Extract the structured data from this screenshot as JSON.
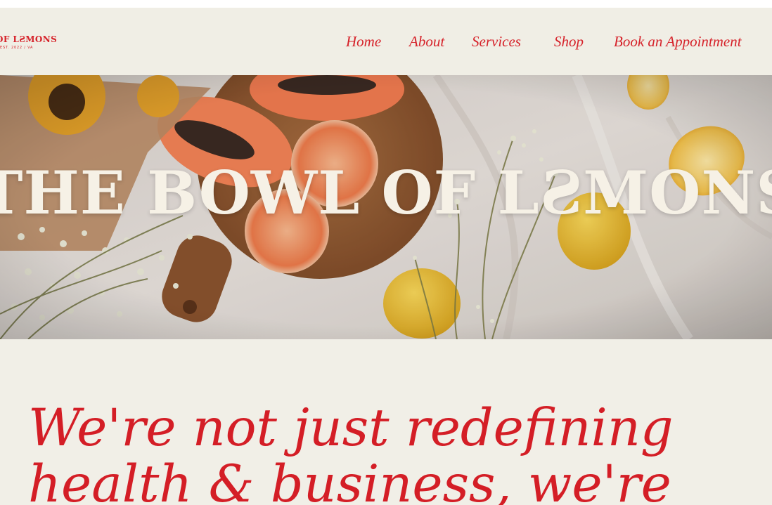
{
  "brand": {
    "logo_text": "OF LƧMONS",
    "logo_sub": "EST. 2022 / VA",
    "accent_color": "#d6222a",
    "background_color": "#f0eee5"
  },
  "nav": {
    "items": [
      {
        "label": "Home"
      },
      {
        "label": "About"
      },
      {
        "label": "Services"
      },
      {
        "label": "Shop"
      },
      {
        "label": "Book an Appointment"
      }
    ]
  },
  "hero": {
    "title": "THE BOWL OF LƧMONS",
    "image_alt": "papaya, grapefruit, lemons, sunflowers and baby's breath on a linen cloth"
  },
  "intro": {
    "line1": "We're not just redefining",
    "line2": "health & business, we're"
  }
}
